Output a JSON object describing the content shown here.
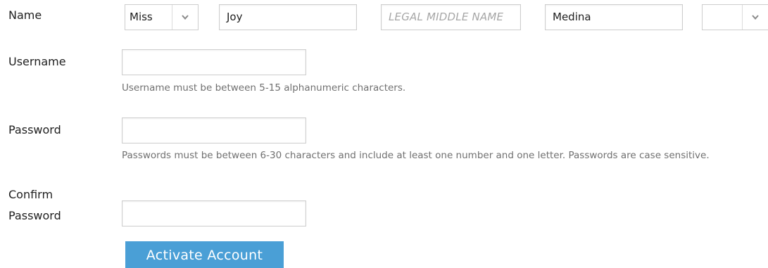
{
  "form": {
    "name": {
      "label": "Name",
      "title_select": {
        "value": "Miss",
        "icon": "chevron-down-icon"
      },
      "first_name": {
        "value": "Joy"
      },
      "middle_name": {
        "value": "",
        "placeholder": "LEGAL MIDDLE NAME"
      },
      "last_name": {
        "value": "Medina"
      },
      "suffix_select": {
        "value": "",
        "icon": "chevron-down-icon"
      }
    },
    "username": {
      "label": "Username",
      "value": "",
      "hint": "Username must be between 5-15 alphanumeric characters."
    },
    "password": {
      "label": "Password",
      "value": "",
      "hint": "Passwords must be between 6-30 characters and include at least one number and one letter. Passwords are case sensitive."
    },
    "confirm_password": {
      "label_line1": "Confirm",
      "label_line2": "Password",
      "value": ""
    },
    "submit": {
      "label": "Activate Account",
      "color": "#4a9fd6"
    }
  }
}
